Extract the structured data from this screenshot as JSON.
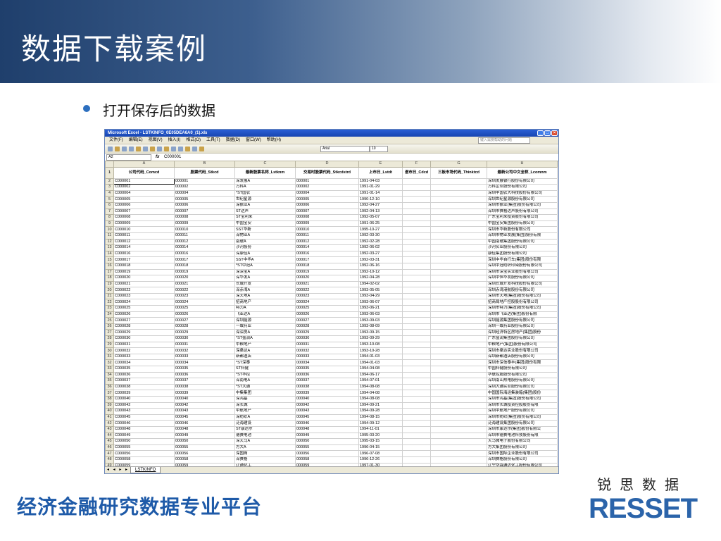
{
  "slide": {
    "title": "数据下载案例",
    "bullet": "打开保存后的数据",
    "footer": "经济金融研究数据专业平台",
    "brand_cn": "锐思数据",
    "brand": "RESSET"
  },
  "excel": {
    "window_title": "Microsoft Excel - LSTKINFO_0E05DEA6A0_(1).xls",
    "menu": [
      "文件(F)",
      "编辑(E)",
      "视图(V)",
      "插入(I)",
      "格式(O)",
      "工具(T)",
      "数据(D)",
      "窗口(W)",
      "帮助(H)"
    ],
    "help_placeholder": "键入需要帮助的问题",
    "font_name": "Arial",
    "font_size": "10",
    "name_box": "A2",
    "fx": "fx",
    "formula_value": "C000001",
    "columns": [
      "A",
      "B",
      "C",
      "D",
      "E",
      "F",
      "G",
      "H"
    ],
    "headers": [
      "公司代码_Comcd",
      "股票代码_Stkcd",
      "最新股票名称_Lstknm",
      "交易时股票代码_Stkcdstrd",
      "上市日_Lstdt",
      "退市日_Cdcd",
      "三板市场代码_Thinktcd",
      "最新公司中文全称_Lcomnm"
    ],
    "rows": [
      [
        "C000001",
        "000001",
        "深发展A",
        "000001",
        "1991-04-03",
        "",
        "",
        "深圳发展银行股份有限公司"
      ],
      [
        "C000002",
        "000002",
        "万科A",
        "000002",
        "1991-01-29",
        "",
        "",
        "万科企业股份有限公司"
      ],
      [
        "C000004",
        "000004",
        "*ST国农",
        "000004",
        "1991-01-14",
        "",
        "",
        "深圳中国农大科技股份有限公司"
      ],
      [
        "C000005",
        "000005",
        "世纪星源",
        "000005",
        "1990-12-10",
        "",
        "",
        "深圳世纪星源股份有限公司"
      ],
      [
        "C000006",
        "000006",
        "深振业A",
        "000006",
        "1992-04-27",
        "",
        "",
        "深圳市振业(集团)股份有限公司"
      ],
      [
        "C000007",
        "000007",
        "ST达声",
        "000007",
        "1992-04-13",
        "",
        "",
        "深圳市赛格达声股份有限公司"
      ],
      [
        "C000008",
        "000008",
        "ST宝利来",
        "000008",
        "1992-05-07",
        "",
        "",
        "广东宝利来投资股份有限公司"
      ],
      [
        "C000009",
        "000009",
        "中国宝安",
        "000009",
        "1991-06-25",
        "",
        "",
        "中国宝安集团股份有限公司"
      ],
      [
        "C000010",
        "000010",
        "SST华新",
        "000010",
        "1995-10-27",
        "",
        "",
        "深圳市华新股份有限公司"
      ],
      [
        "C000011",
        "000011",
        "深物业A",
        "000011",
        "1992-03-30",
        "",
        "",
        "深圳市物业发展(集团)股份有限"
      ],
      [
        "C000012",
        "000012",
        "南玻A",
        "000012",
        "1992-02-28",
        "",
        "",
        "中国南玻集团股份有限公司"
      ],
      [
        "C000014",
        "000014",
        "沙河股份",
        "000014",
        "1992-06-02",
        "",
        "",
        "沙河实业股份有限公司"
      ],
      [
        "C000016",
        "000016",
        "深康佳A",
        "000016",
        "1992-03-27",
        "",
        "",
        "康佳集团股份有限公司"
      ],
      [
        "C000017",
        "000017",
        "SST中华A",
        "000017",
        "1992-03-31",
        "",
        "",
        "深圳中华自行车(集团)股份有限"
      ],
      [
        "C000018",
        "000018",
        "*ST中冠A",
        "000018",
        "1992-06-16",
        "",
        "",
        "深圳中冠纺织印染股份有限公司"
      ],
      [
        "C000019",
        "000019",
        "深深宝A",
        "000019",
        "1992-10-12",
        "",
        "",
        "深圳市深宝实业股份有限公司"
      ],
      [
        "C000020",
        "000020",
        "深华发A",
        "000020",
        "1992-04-28",
        "",
        "",
        "深圳中恒华发股份有限公司"
      ],
      [
        "C000021",
        "000021",
        "长城开发",
        "000021",
        "1994-02-02",
        "",
        "",
        "深圳长城开发科技股份有限公司"
      ],
      [
        "C000022",
        "000022",
        "深赤湾A",
        "000022",
        "1993-05-05",
        "",
        "",
        "深圳赤湾港航股份有限公司"
      ],
      [
        "C000023",
        "000023",
        "深天地A",
        "000023",
        "1993-04-29",
        "",
        "",
        "深圳市天地(集团)股份有限公司"
      ],
      [
        "C000024",
        "000024",
        "招商地产",
        "000024",
        "1993-06-07",
        "",
        "",
        "招商局地产控股股份有限公司"
      ],
      [
        "C000025",
        "000025",
        "特力A",
        "000025",
        "1993-06-21",
        "",
        "",
        "深圳市特力(集团)股份有限公司"
      ],
      [
        "C000026",
        "000026",
        "飞亚达A",
        "000026",
        "1993-06-03",
        "",
        "",
        "深圳市飞亚达(集团)股份有限"
      ],
      [
        "C000027",
        "000027",
        "深圳能源",
        "000027",
        "1993-09-03",
        "",
        "",
        "深圳能源集团股份有限公司"
      ],
      [
        "C000028",
        "000028",
        "一致药业",
        "000028",
        "1993-08-09",
        "",
        "",
        "深圳一致药业股份有限公司"
      ],
      [
        "C000029",
        "000029",
        "深深房A",
        "000029",
        "1993-09-15",
        "",
        "",
        "深圳经济特区房地产(集团)股份"
      ],
      [
        "C000030",
        "000030",
        "*ST盛润A",
        "000030",
        "1993-09-29",
        "",
        "",
        "广东盛润集团股份有限公司"
      ],
      [
        "C000031",
        "000031",
        "中粮地产",
        "000031",
        "1993-10-08",
        "",
        "",
        "中粮地产(集团)股份有限公司"
      ],
      [
        "C000032",
        "000032",
        "深桑达A",
        "000032",
        "1993-10-28",
        "",
        "",
        "深圳市桑达实业股份有限公司"
      ],
      [
        "C000033",
        "000033",
        "新都酒店",
        "000033",
        "1994-01-03",
        "",
        "",
        "深圳新都酒店股份有限公司"
      ],
      [
        "C000034",
        "000034",
        "*ST深泰",
        "000034",
        "1994-01-03",
        "",
        "",
        "深圳市深信泰丰(集团)股份有限"
      ],
      [
        "C000035",
        "000035",
        "ST科健",
        "000035",
        "1994-04-08",
        "",
        "",
        "中国科健股份有限公司"
      ],
      [
        "C000036",
        "000036",
        "*ST华控",
        "000036",
        "1994-06-17",
        "",
        "",
        "华联控股股份有限公司"
      ],
      [
        "C000037",
        "000037",
        "深南电A",
        "000037",
        "1994-07-01",
        "",
        "",
        "深圳南山热电股份有限公司"
      ],
      [
        "C000038",
        "000038",
        "*ST大通",
        "000038",
        "1994-08-08",
        "",
        "",
        "深圳大通实业股份有限公司"
      ],
      [
        "C000039",
        "000039",
        "中集集团",
        "000039",
        "1994-04-08",
        "",
        "",
        "中国国际海运集装箱(集团)股份"
      ],
      [
        "C000040",
        "000040",
        "深鸿基",
        "000040",
        "1994-08-08",
        "",
        "",
        "深圳市鸿基(集团)股份有限公司"
      ],
      [
        "C000042",
        "000042",
        "深长城",
        "000042",
        "1994-09-21",
        "",
        "",
        "深圳市长城投资控股股份有限"
      ],
      [
        "C000043",
        "000043",
        "中航地产",
        "000043",
        "1994-09-28",
        "",
        "",
        "深圳中航地产股份有限公司"
      ],
      [
        "C000045",
        "000045",
        "深纺织A",
        "000045",
        "1994-08-15",
        "",
        "",
        "深圳市纺织(集团)股份有限公司"
      ],
      [
        "C000046",
        "000046",
        "泛海建设",
        "000046",
        "1994-09-12",
        "",
        "",
        "泛海建设集团股份有限公司"
      ],
      [
        "C000048",
        "000048",
        "ST康达尔",
        "000048",
        "1994-11-01",
        "",
        "",
        "深圳市康达尔(集团)股份有限公"
      ],
      [
        "C000049",
        "000049",
        "德赛电池",
        "000049",
        "1995-03-20",
        "",
        "",
        "深圳市德赛电池科技股份有限"
      ],
      [
        "C000050",
        "000050",
        "深天马A",
        "000050",
        "1995-03-15",
        "",
        "",
        "天马微电子股份有限公司"
      ],
      [
        "C000055",
        "000055",
        "方大A",
        "000055",
        "1996-04-15",
        "",
        "",
        "方大集团股份有限公司"
      ],
      [
        "C000056",
        "000056",
        "深国商",
        "000056",
        "1996-07-08",
        "",
        "",
        "深圳市国际企业股份有限公司"
      ],
      [
        "C000058",
        "000058",
        "深赛格",
        "000058",
        "1996-12-26",
        "",
        "",
        "深圳赛格股份有限公司"
      ],
      [
        "C000059",
        "000059",
        "辽通化工",
        "000059",
        "1997-01-30",
        "",
        "",
        "辽宁华锦通达化工股份有限公司"
      ]
    ],
    "sheet_nav": "◂ ◂ ▸ ▸",
    "sheet_tab": "LSTKINFO"
  }
}
